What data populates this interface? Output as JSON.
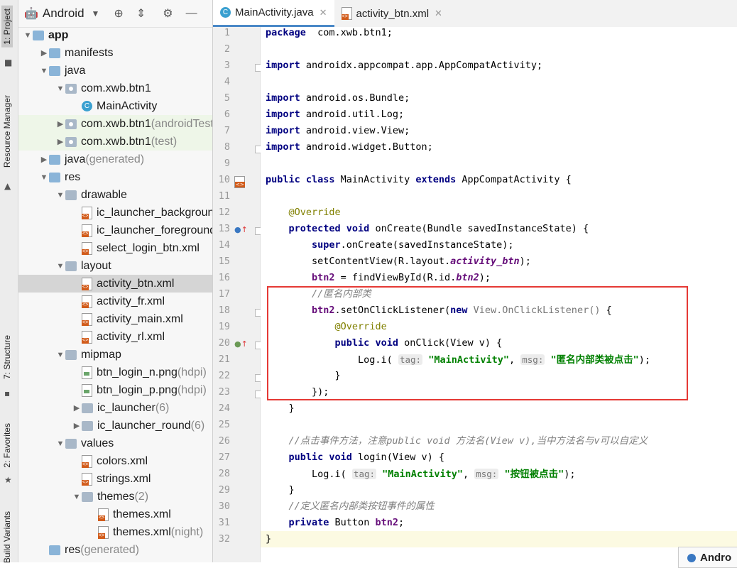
{
  "side_tabs": [
    {
      "label": "1: Project",
      "active": true
    },
    {
      "label": "Resource Manager",
      "active": false
    },
    {
      "label": "7: Structure",
      "active": false
    },
    {
      "label": "2: Favorites",
      "active": false
    },
    {
      "label": "Build Variants",
      "active": false
    }
  ],
  "project_panel": {
    "view_mode": "Android",
    "tree": [
      {
        "label": "app",
        "depth": 0,
        "arrow": "down",
        "icon": "module",
        "bold": true
      },
      {
        "label": "manifests",
        "depth": 1,
        "arrow": "right",
        "icon": "folder-blue"
      },
      {
        "label": "java",
        "depth": 1,
        "arrow": "down",
        "icon": "folder-blue"
      },
      {
        "label": "com.xwb.btn1",
        "depth": 2,
        "arrow": "down",
        "icon": "package"
      },
      {
        "label": "MainActivity",
        "depth": 3,
        "arrow": "",
        "icon": "class"
      },
      {
        "label": "com.xwb.btn1",
        "suffix": " (androidTest)",
        "depth": 2,
        "arrow": "right",
        "icon": "package",
        "test": true
      },
      {
        "label": "com.xwb.btn1",
        "suffix": " (test)",
        "depth": 2,
        "arrow": "right",
        "icon": "package",
        "test": true
      },
      {
        "label": "java",
        "suffix": " (generated)",
        "depth": 1,
        "arrow": "right",
        "icon": "folder-gen"
      },
      {
        "label": "res",
        "depth": 1,
        "arrow": "down",
        "icon": "folder-res"
      },
      {
        "label": "drawable",
        "depth": 2,
        "arrow": "down",
        "icon": "folder"
      },
      {
        "label": "ic_launcher_background.xml",
        "depth": 3,
        "arrow": "",
        "icon": "xml"
      },
      {
        "label": "ic_launcher_foreground.xml",
        "depth": 3,
        "arrow": "",
        "icon": "xml"
      },
      {
        "label": "select_login_btn.xml",
        "depth": 3,
        "arrow": "",
        "icon": "xml"
      },
      {
        "label": "layout",
        "depth": 2,
        "arrow": "down",
        "icon": "folder"
      },
      {
        "label": "activity_btn.xml",
        "depth": 3,
        "arrow": "",
        "icon": "xml",
        "selected": true
      },
      {
        "label": "activity_fr.xml",
        "depth": 3,
        "arrow": "",
        "icon": "xml"
      },
      {
        "label": "activity_main.xml",
        "depth": 3,
        "arrow": "",
        "icon": "xml"
      },
      {
        "label": "activity_rl.xml",
        "depth": 3,
        "arrow": "",
        "icon": "xml"
      },
      {
        "label": "mipmap",
        "depth": 2,
        "arrow": "down",
        "icon": "folder"
      },
      {
        "label": "btn_login_n.png",
        "suffix": " (hdpi)",
        "depth": 3,
        "arrow": "",
        "icon": "png"
      },
      {
        "label": "btn_login_p.png",
        "suffix": " (hdpi)",
        "depth": 3,
        "arrow": "",
        "icon": "png"
      },
      {
        "label": "ic_launcher",
        "suffix": " (6)",
        "depth": 3,
        "arrow": "right",
        "icon": "folder"
      },
      {
        "label": "ic_launcher_round",
        "suffix": " (6)",
        "depth": 3,
        "arrow": "right",
        "icon": "folder"
      },
      {
        "label": "values",
        "depth": 2,
        "arrow": "down",
        "icon": "folder"
      },
      {
        "label": "colors.xml",
        "depth": 3,
        "arrow": "",
        "icon": "xml"
      },
      {
        "label": "strings.xml",
        "depth": 3,
        "arrow": "",
        "icon": "xml"
      },
      {
        "label": "themes",
        "suffix": " (2)",
        "depth": 3,
        "arrow": "down",
        "icon": "folder"
      },
      {
        "label": "themes.xml",
        "depth": 4,
        "arrow": "",
        "icon": "xml"
      },
      {
        "label": "themes.xml",
        "suffix": " (night)",
        "depth": 4,
        "arrow": "",
        "icon": "xml"
      },
      {
        "label": "res",
        "suffix": " (generated)",
        "depth": 1,
        "arrow": "",
        "icon": "folder-gen"
      }
    ]
  },
  "tabs": [
    {
      "label": "MainActivity.java",
      "active": true,
      "icon": "class"
    },
    {
      "label": "activity_btn.xml",
      "active": false,
      "icon": "xml"
    }
  ],
  "code": {
    "current_line": 32,
    "lines": [
      [
        [
          "kw",
          "package"
        ],
        [
          "",
          "  com.xwb.btn1;"
        ]
      ],
      [],
      [
        [
          "kw",
          "import"
        ],
        [
          "",
          " androidx.appcompat.app.AppCompatActivity;"
        ]
      ],
      [],
      [
        [
          "kw",
          "import"
        ],
        [
          "",
          " android.os.Bundle;"
        ]
      ],
      [
        [
          "kw",
          "import"
        ],
        [
          "",
          " android.util.Log;"
        ]
      ],
      [
        [
          "kw",
          "import"
        ],
        [
          "",
          " android.view.View;"
        ]
      ],
      [
        [
          "kw",
          "import"
        ],
        [
          "",
          " android.widget.Button;"
        ]
      ],
      [],
      [
        [
          "kw",
          "public class"
        ],
        [
          "",
          " MainActivity "
        ],
        [
          "kw",
          "extends"
        ],
        [
          "",
          " AppCompatActivity {"
        ]
      ],
      [],
      [
        [
          "",
          "    "
        ],
        [
          "ann",
          "@Override"
        ]
      ],
      [
        [
          "",
          "    "
        ],
        [
          "kw",
          "protected void"
        ],
        [
          "",
          " onCreate(Bundle savedInstanceState) {"
        ]
      ],
      [
        [
          "",
          "        "
        ],
        [
          "kw",
          "super"
        ],
        [
          "",
          ".onCreate(savedInstanceState);"
        ]
      ],
      [
        [
          "",
          "        setContentView(R.layout."
        ],
        [
          "fldi",
          "activity_btn"
        ],
        [
          "",
          ");"
        ]
      ],
      [
        [
          "",
          "        "
        ],
        [
          "fld",
          "btn2"
        ],
        [
          "",
          " = findViewById(R.id."
        ],
        [
          "fldi",
          "btn2"
        ],
        [
          "",
          ");"
        ]
      ],
      [
        [
          "",
          "        "
        ],
        [
          "cm",
          "//匿名内部类"
        ]
      ],
      [
        [
          "",
          "        "
        ],
        [
          "fld",
          "btn2"
        ],
        [
          "",
          ".setOnClickListener("
        ],
        [
          "kw",
          "new"
        ],
        [
          "",
          " "
        ],
        [
          "gtype",
          "View.OnClickListener()"
        ],
        [
          "",
          " {"
        ]
      ],
      [
        [
          "",
          "            "
        ],
        [
          "ann",
          "@Override"
        ]
      ],
      [
        [
          "",
          "            "
        ],
        [
          "kw",
          "public void"
        ],
        [
          "",
          " onClick(View v) {"
        ]
      ],
      [
        [
          "",
          "                Log.i( "
        ],
        [
          "hint",
          "tag:"
        ],
        [
          "",
          " "
        ],
        [
          "str",
          "\"MainActivity\""
        ],
        [
          "",
          ", "
        ],
        [
          "hint",
          "msg:"
        ],
        [
          "",
          " "
        ],
        [
          "str",
          "\"匿名内部类被点击\""
        ],
        [
          "",
          ");"
        ]
      ],
      [
        [
          "",
          "            }"
        ]
      ],
      [
        [
          "",
          "        });"
        ]
      ],
      [
        [
          "",
          "    }"
        ]
      ],
      [],
      [
        [
          "",
          "    "
        ],
        [
          "cm",
          "//点击事件方法，注意public void 方法名(View v),当中方法名与v可以自定义"
        ]
      ],
      [
        [
          "",
          "    "
        ],
        [
          "kw",
          "public void"
        ],
        [
          "",
          " login(View v) {"
        ]
      ],
      [
        [
          "",
          "        Log.i( "
        ],
        [
          "hint",
          "tag:"
        ],
        [
          "",
          " "
        ],
        [
          "str",
          "\"MainActivity\""
        ],
        [
          "",
          ", "
        ],
        [
          "hint",
          "msg:"
        ],
        [
          "",
          " "
        ],
        [
          "str",
          "\"按钮被点击\""
        ],
        [
          "",
          ");"
        ]
      ],
      [
        [
          "",
          "    }"
        ]
      ],
      [
        [
          "",
          "    "
        ],
        [
          "cm",
          "//定义匿名内部类按钮事件的属性"
        ]
      ],
      [
        [
          "",
          "    "
        ],
        [
          "kw",
          "private"
        ],
        [
          "",
          " Button "
        ],
        [
          "fld",
          "btn2"
        ],
        [
          "",
          ";"
        ]
      ],
      [
        [
          "",
          "}"
        ]
      ]
    ],
    "gutter_marks": [
      {
        "line": 10,
        "icon": "xml-layout-icon"
      },
      {
        "line": 13,
        "icon": "override-up-icon"
      },
      {
        "line": 20,
        "icon": "implements-up-icon"
      }
    ],
    "fold_lines": [
      3,
      8,
      13,
      18,
      20,
      22,
      23
    ]
  },
  "popup": {
    "label": "Andro"
  }
}
